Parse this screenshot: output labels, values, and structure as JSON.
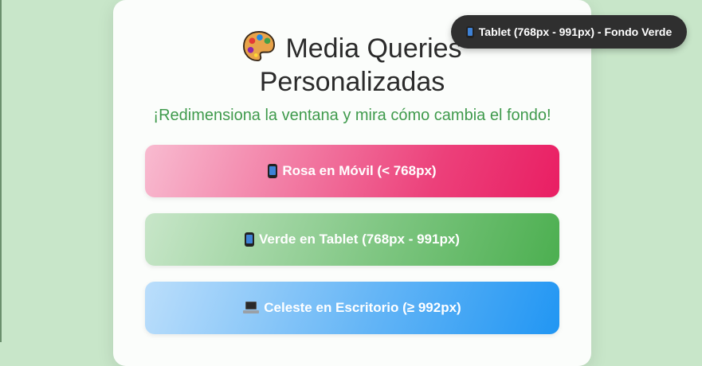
{
  "header": {
    "title_line1": "Media Queries",
    "title_line2": "Personalizadas",
    "title_icon": "palette-icon",
    "subtitle": "¡Redimensiona la ventana y mira cómo cambia el fondo!"
  },
  "boxes": [
    {
      "icon": "phone-icon",
      "label": "Rosa en Móvil (< 768px)",
      "color_from": "#f8bbd0",
      "color_to": "#e91e63"
    },
    {
      "icon": "phone-icon",
      "label": "Verde en Tablet (768px - 991px)",
      "color_from": "#c8e6c9",
      "color_to": "#4caf50"
    },
    {
      "icon": "laptop-icon",
      "label": "Celeste en Escritorio (≥ 992px)",
      "color_from": "#bbdefb",
      "color_to": "#2196f3"
    }
  ],
  "indicator": {
    "icon": "phone-icon",
    "label": "Tablet (768px - 991px) - Fondo Verde"
  },
  "colors": {
    "page_background": "#c8e6c9",
    "subtitle": "#3f9a4c",
    "badge_background": "#2f2f2f"
  }
}
